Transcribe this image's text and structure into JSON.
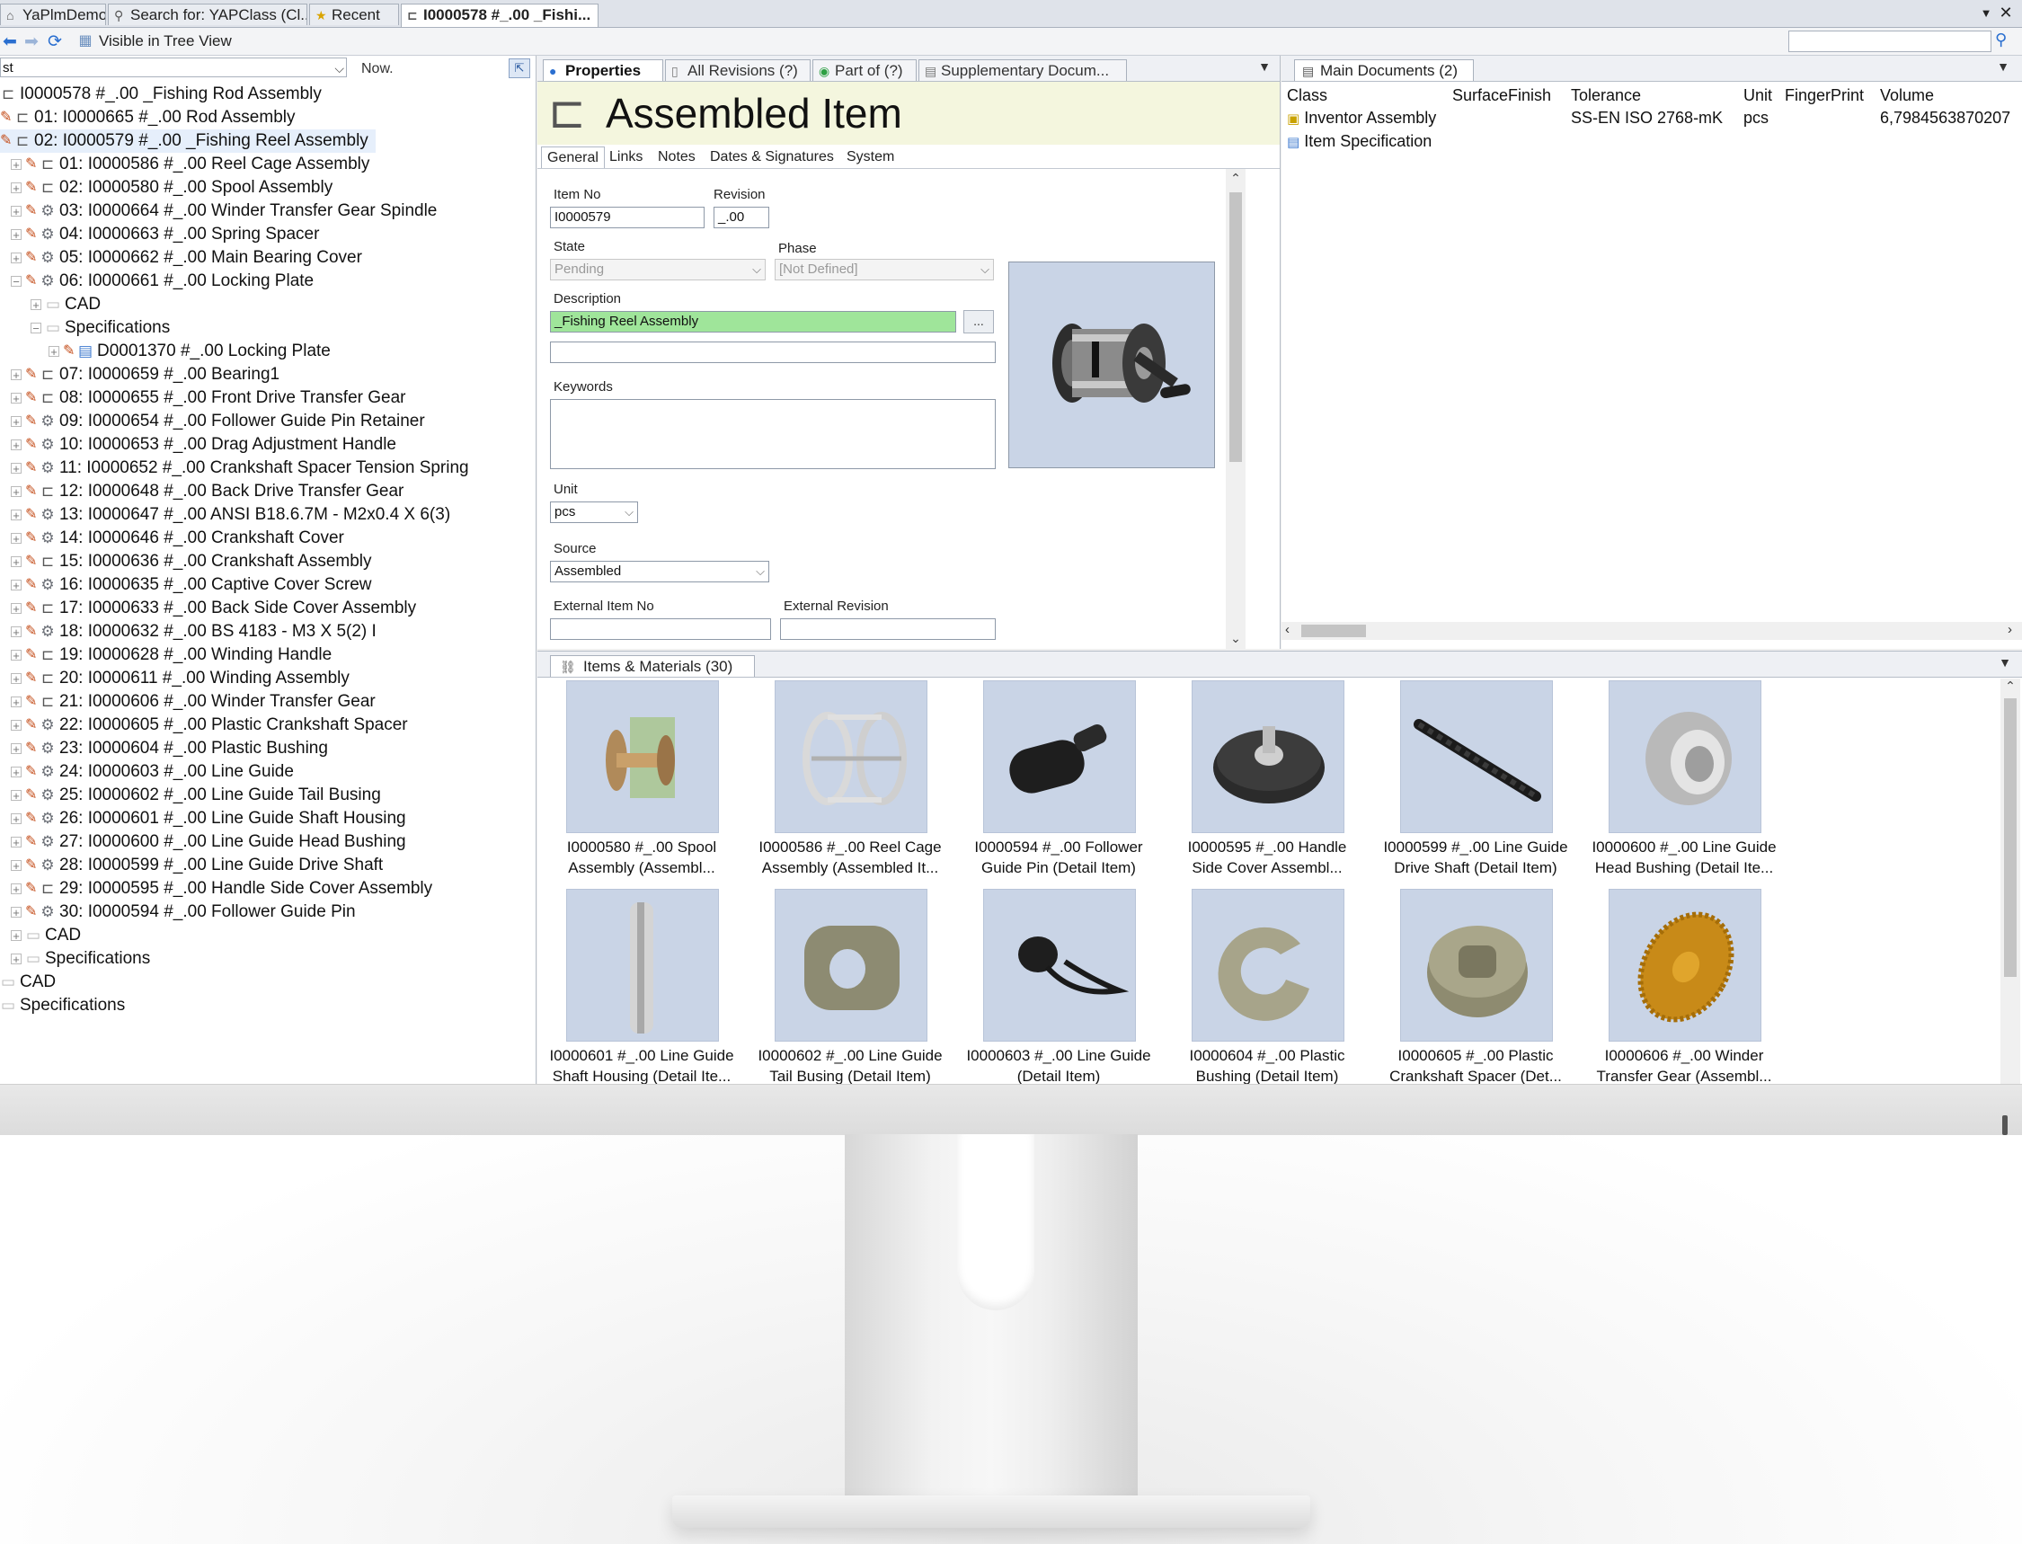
{
  "tabs": [
    {
      "label": "YaPlmDemo",
      "icon": "home-icon"
    },
    {
      "label": "Search for: YAPClass (Cl...",
      "icon": "search-icon"
    },
    {
      "label": "Recent",
      "icon": "star-icon"
    },
    {
      "label": "I0000578 #_.00 _Fishi...",
      "icon": "assembly-icon"
    }
  ],
  "toolbar": {
    "visible_in_tree": "Visible in Tree View",
    "search_value": ""
  },
  "tree": {
    "filter_value": "st",
    "now_label": "Now.",
    "rows": [
      {
        "label": "I0000578 #_.00 _Fishing Rod Assembly",
        "icon": "assembly"
      },
      {
        "label": "01: I0000665 #_.00 Rod Assembly",
        "icon": "assembly"
      },
      {
        "label": "02: I0000579 #_.00 _Fishing Reel Assembly",
        "icon": "assembly"
      },
      {
        "label": "01: I0000586 #_.00 Reel Cage Assembly",
        "icon": "assembly"
      },
      {
        "label": "02: I0000580 #_.00 Spool Assembly",
        "icon": "assembly"
      },
      {
        "label": "03: I0000664 #_.00 Winder Transfer Gear Spindle",
        "icon": "part"
      },
      {
        "label": "04: I0000663 #_.00 Spring Spacer",
        "icon": "part"
      },
      {
        "label": "05: I0000662 #_.00 Main Bearing Cover",
        "icon": "part"
      },
      {
        "label": "06: I0000661 #_.00 Locking Plate",
        "icon": "part"
      },
      {
        "label": "CAD",
        "icon": "folder"
      },
      {
        "label": "Specifications",
        "icon": "folder"
      },
      {
        "label": "D0001370 #_.00 Locking Plate",
        "icon": "doc"
      },
      {
        "label": "07: I0000659 #_.00 Bearing1",
        "icon": "assembly"
      },
      {
        "label": "08: I0000655 #_.00 Front Drive Transfer Gear",
        "icon": "assembly"
      },
      {
        "label": "09: I0000654 #_.00 Follower Guide Pin Retainer",
        "icon": "part"
      },
      {
        "label": "10: I0000653 #_.00 Drag Adjustment Handle",
        "icon": "part"
      },
      {
        "label": "11: I0000652 #_.00 Crankshaft Spacer Tension Spring",
        "icon": "part"
      },
      {
        "label": "12: I0000648 #_.00 Back Drive Transfer Gear",
        "icon": "assembly"
      },
      {
        "label": "13: I0000647 #_.00 ANSI B18.6.7M - M2x0.4 X 6(3)",
        "icon": "part"
      },
      {
        "label": "14: I0000646 #_.00 Crankshaft Cover",
        "icon": "part"
      },
      {
        "label": "15: I0000636 #_.00 Crankshaft Assembly",
        "icon": "assembly"
      },
      {
        "label": "16: I0000635 #_.00 Captive Cover Screw",
        "icon": "part"
      },
      {
        "label": "17: I0000633 #_.00 Back Side Cover Assembly",
        "icon": "assembly"
      },
      {
        "label": "18: I0000632 #_.00 BS 4183 - M3 X 5(2) I",
        "icon": "part"
      },
      {
        "label": "19: I0000628 #_.00 Winding Handle",
        "icon": "assembly"
      },
      {
        "label": "20: I0000611 #_.00 Winding Assembly",
        "icon": "assembly"
      },
      {
        "label": "21: I0000606 #_.00 Winder Transfer Gear",
        "icon": "assembly"
      },
      {
        "label": "22: I0000605 #_.00 Plastic Crankshaft Spacer",
        "icon": "part"
      },
      {
        "label": "23: I0000604 #_.00 Plastic Bushing",
        "icon": "part"
      },
      {
        "label": "24: I0000603 #_.00 Line Guide",
        "icon": "part"
      },
      {
        "label": "25: I0000602 #_.00 Line Guide Tail Busing",
        "icon": "part"
      },
      {
        "label": "26: I0000601 #_.00 Line Guide Shaft Housing",
        "icon": "part"
      },
      {
        "label": "27: I0000600 #_.00 Line Guide Head Bushing",
        "icon": "part"
      },
      {
        "label": "28: I0000599 #_.00 Line Guide Drive Shaft",
        "icon": "part"
      },
      {
        "label": "29: I0000595 #_.00 Handle Side Cover Assembly",
        "icon": "assembly"
      },
      {
        "label": "30: I0000594 #_.00 Follower Guide Pin",
        "icon": "part"
      },
      {
        "label": "CAD",
        "icon": "folder"
      },
      {
        "label": "Specifications",
        "icon": "folder"
      },
      {
        "label": "CAD",
        "icon": "folder"
      },
      {
        "label": "Specifications",
        "icon": "folder"
      }
    ]
  },
  "props": {
    "tabs": [
      "Properties",
      "All Revisions (?)",
      "Part of (?)",
      "Supplementary Docum..."
    ],
    "title": "Assembled Item",
    "subtabs": [
      "General",
      "Links",
      "Notes",
      "Dates & Signatures",
      "System"
    ],
    "fields": {
      "item_no_label": "Item No",
      "item_no": "I0000579",
      "revision_label": "Revision",
      "revision": "_.00",
      "state_label": "State",
      "state": "Pending",
      "phase_label": "Phase",
      "phase": "[Not Defined]",
      "description_label": "Description",
      "description": "_Fishing Reel Assembly",
      "description2": "",
      "dots": "...",
      "keywords_label": "Keywords",
      "unit_label": "Unit",
      "unit": "pcs",
      "source_label": "Source",
      "source": "Assembled",
      "ext_item_no_label": "External Item No",
      "ext_item_no": "",
      "ext_revision_label": "External Revision",
      "ext_revision": ""
    }
  },
  "docs": {
    "tab": "Main Documents (2)",
    "columns": [
      "Class",
      "SurfaceFinish",
      "Tolerance",
      "Unit",
      "FingerPrint",
      "Volume"
    ],
    "rows": [
      {
        "class": "Inventor Assembly",
        "surface": "",
        "tolerance": "SS-EN ISO 2768-mK",
        "unit": "pcs",
        "fingerprint": "",
        "volume": "6,7984563870207"
      },
      {
        "class": "Item Specification",
        "surface": "",
        "tolerance": "",
        "unit": "",
        "fingerprint": "",
        "volume": ""
      }
    ]
  },
  "items": {
    "tab": "Items & Materials (30)",
    "tiles": [
      {
        "line1": "I0000580 #_.00 Spool",
        "line2": "Assembly (Assembl...",
        "shape": "spool"
      },
      {
        "line1": "I0000586 #_.00 Reel Cage",
        "line2": "Assembly (Assembled It...",
        "shape": "cage"
      },
      {
        "line1": "I0000594 #_.00 Follower",
        "line2": "Guide Pin (Detail Item)",
        "shape": "pin"
      },
      {
        "line1": "I0000595 #_.00 Handle",
        "line2": "Side Cover Assembl...",
        "shape": "cover"
      },
      {
        "line1": "I0000599 #_.00 Line Guide",
        "line2": "Drive Shaft (Detail Item)",
        "shape": "shaft"
      },
      {
        "line1": "I0000600 #_.00 Line Guide",
        "line2": "Head Bushing (Detail Ite...",
        "shape": "bushing"
      },
      {
        "line1": "I0000601 #_.00 Line Guide",
        "line2": "Shaft Housing (Detail Ite...",
        "shape": "housing"
      },
      {
        "line1": "I0000602 #_.00 Line Guide",
        "line2": "Tail Busing (Detail Item)",
        "shape": "tail"
      },
      {
        "line1": "I0000603 #_.00 Line Guide",
        "line2": "(Detail Item)",
        "shape": "guide"
      },
      {
        "line1": "I0000604 #_.00 Plastic",
        "line2": "Bushing (Detail Item)",
        "shape": "cring"
      },
      {
        "line1": "I0000605 #_.00 Plastic",
        "line2": "Crankshaft Spacer (Det...",
        "shape": "spacer"
      },
      {
        "line1": "I0000606 #_.00 Winder",
        "line2": "Transfer Gear (Assembl...",
        "shape": "gear"
      }
    ]
  }
}
